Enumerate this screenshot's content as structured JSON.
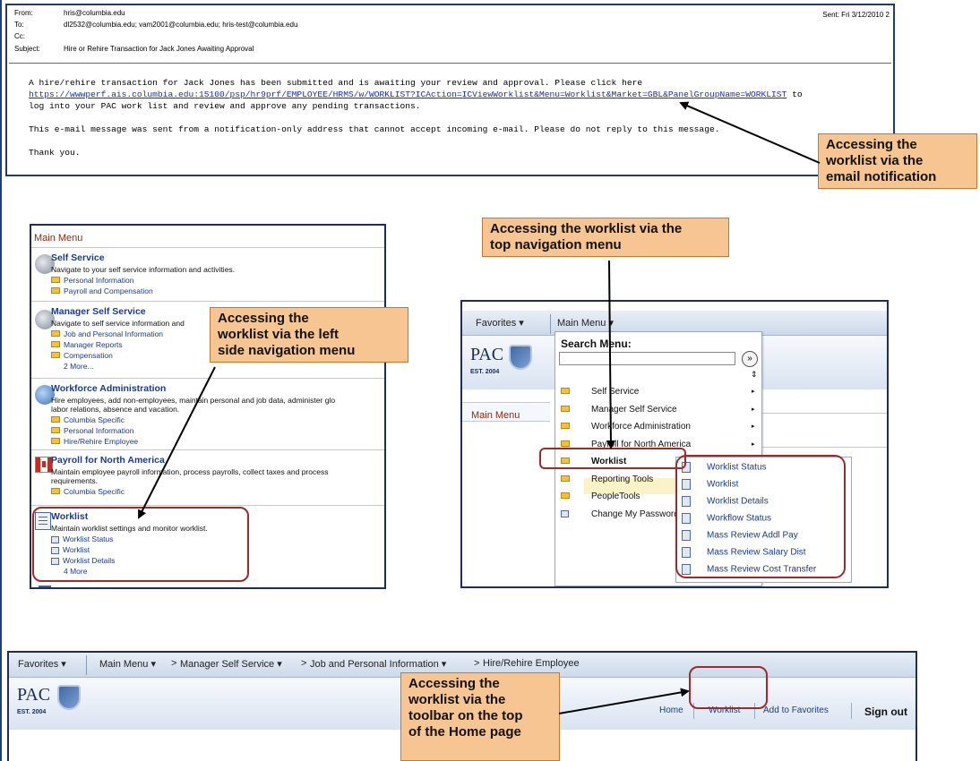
{
  "email": {
    "from_label": "From:",
    "from_value": "hris@columbia.edu",
    "to_label": "To:",
    "to_value": "dl2532@columbia.edu; vam2001@columbia.edu; hris-test@columbia.edu",
    "cc_label": "Cc:",
    "cc_value": "",
    "subject_label": "Subject:",
    "subject_value": "Hire or Rehire Transaction for Jack Jones Awaiting Approval",
    "sent": "Sent:   Fri 3/12/2010 2",
    "body_line1": "A hire/rehire transaction for Jack Jones has been submitted and is awaiting your review and approval.  Please click here",
    "body_link": "https://wwwperf.ais.columbia.edu:15100/psp/hr9prf/EMPLOYEE/HRMS/w/WORKLIST?ICAction=ICViewWorklist&Menu=Worklist&Market=GBL&PanelGroupName=WORKLIST",
    "body_link_suffix": " to",
    "body_line3": "log into your PAC work list and review and approve any pending transactions.",
    "body_line4": "This e-mail message was sent from a notification-only address that cannot accept incoming e-mail. Please do not reply to this message.",
    "body_line5": "Thank you."
  },
  "callouts": {
    "email": [
      "Accessing the",
      "worklist via the",
      "email notification"
    ],
    "left": [
      "Accessing the",
      "worklist via the left",
      "side navigation menu"
    ],
    "top": [
      "Accessing the worklist via the",
      "top navigation menu"
    ],
    "toolbar": [
      "Accessing the",
      "worklist via the",
      "toolbar on the top",
      "of the Home page"
    ]
  },
  "left_menu": {
    "title": "Main Menu",
    "self_service": {
      "heading": "Self Service",
      "desc": "Navigate to your self service information and activities.",
      "items": [
        "Personal Information",
        "Payroll and Compensation"
      ]
    },
    "manager": {
      "heading": "Manager Self Service",
      "desc": "Navigate to self service information and",
      "items": [
        "Job and Personal Information",
        "Manager Reports",
        "Compensation"
      ],
      "more": "2 More..."
    },
    "workforce": {
      "heading": "Workforce Administration",
      "desc1": "Hire employees, add non-employees, maintain personal and job data, administer glo",
      "desc2": "labor relations, absence and vacation.",
      "items": [
        "Columbia Specific",
        "Personal Information",
        "Hire/Rehire Employee"
      ]
    },
    "payroll": {
      "heading": "Payroll for North America",
      "desc1": "Maintain employee payroll information, process payrolls, collect taxes and process",
      "desc2": "requirements.",
      "items": [
        "Columbia Specific"
      ]
    },
    "worklist": {
      "heading": "Worklist",
      "desc": "Maintain worklist settings and monitor worklist.",
      "items": [
        "Worklist Status",
        "Worklist",
        "Worklist Details"
      ],
      "more": "4 More"
    }
  },
  "top_nav": {
    "favorites": "Favorites",
    "main_menu": "Main Menu",
    "brand": "PAC",
    "est": "EST. 2004",
    "main_menu_label": "Main Menu",
    "search_title": "Search Menu:",
    "search_value": "",
    "go_glyph": "»",
    "sort_glyph": "⇕",
    "items": [
      "Self Service",
      "Manager Self Service",
      "Workforce Administration",
      "Payroll for North America",
      "Worklist",
      "Reporting Tools",
      "PeopleTools",
      "Change My Password"
    ],
    "flyout": [
      "Worklist Status",
      "Worklist",
      "Worklist Details",
      "Workflow Status",
      "Mass Review Addl Pay",
      "Mass Review Salary Dist",
      "Mass Review Cost Transfer"
    ]
  },
  "toolbar": {
    "favorites": "Favorites",
    "breadcrumb_main": "Main Menu",
    "breadcrumb_mss": "Manager Self Service",
    "breadcrumb_jpi": "Job and Personal Information",
    "breadcrumb_hire": "Hire/Rehire Employee",
    "brand": "PAC",
    "est": "EST. 2004",
    "home": "Home",
    "worklist": "Worklist",
    "add_fav": "Add to Favorites",
    "sign_out": "Sign out"
  },
  "colors": {
    "callout_bg": "#f6c592",
    "highlight_border": "#9e2b2b",
    "link": "#1a3b88",
    "frame": "#1f2f52"
  }
}
